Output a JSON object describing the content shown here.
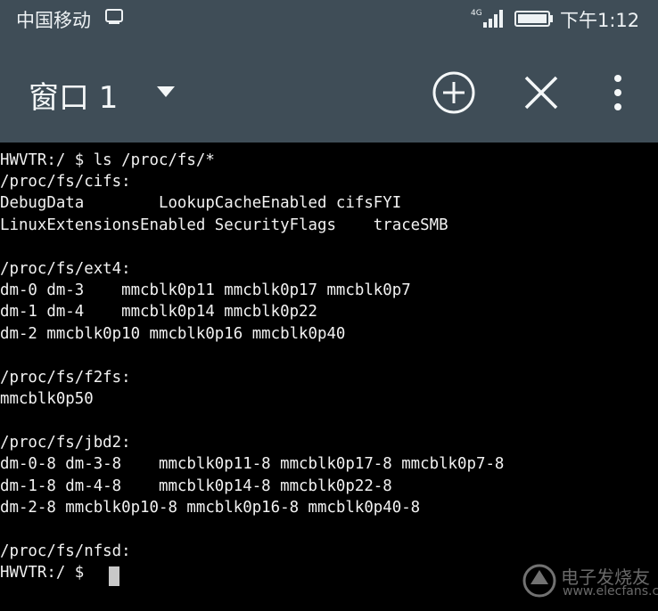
{
  "status_bar": {
    "carrier": "中国移动",
    "network": "4G",
    "time": "下午1:12"
  },
  "toolbar": {
    "title": "窗口 1"
  },
  "terminal": {
    "lines": [
      "HWVTR:/ $ ls /proc/fs/*",
      "/proc/fs/cifs:",
      "DebugData        LookupCacheEnabled cifsFYI",
      "LinuxExtensionsEnabled SecurityFlags    traceSMB",
      "",
      "/proc/fs/ext4:",
      "dm-0 dm-3    mmcblk0p11 mmcblk0p17 mmcblk0p7",
      "dm-1 dm-4    mmcblk0p14 mmcblk0p22",
      "dm-2 mmcblk0p10 mmcblk0p16 mmcblk0p40",
      "",
      "/proc/fs/f2fs:",
      "mmcblk0p50",
      "",
      "/proc/fs/jbd2:",
      "dm-0-8 dm-3-8    mmcblk0p11-8 mmcblk0p17-8 mmcblk0p7-8",
      "dm-1-8 dm-4-8    mmcblk0p14-8 mmcblk0p22-8",
      "dm-2-8 mmcblk0p10-8 mmcblk0p16-8 mmcblk0p40-8",
      "",
      "/proc/fs/nfsd:",
      "HWVTR:/ $"
    ]
  },
  "watermark": {
    "text": "电子发烧友",
    "url": "www.elecfans.com"
  },
  "colors": {
    "header_bg": "#3f4d57",
    "terminal_bg": "#000000",
    "terminal_fg": "#f2f2f2"
  }
}
